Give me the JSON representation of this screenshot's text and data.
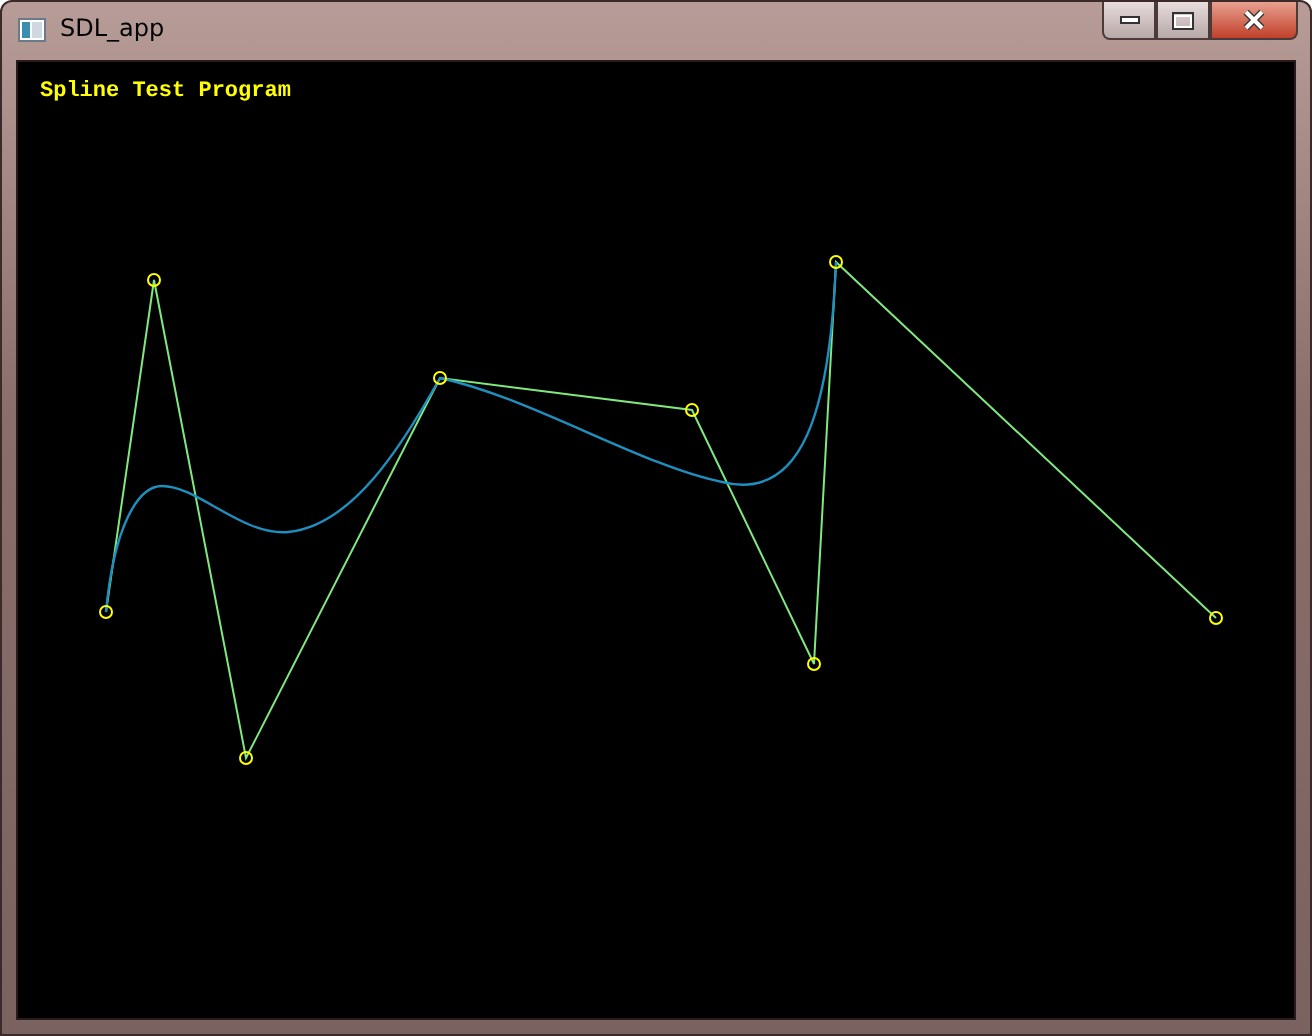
{
  "window": {
    "title": "SDL_app"
  },
  "canvas": {
    "heading": "Spline Test Program"
  }
}
